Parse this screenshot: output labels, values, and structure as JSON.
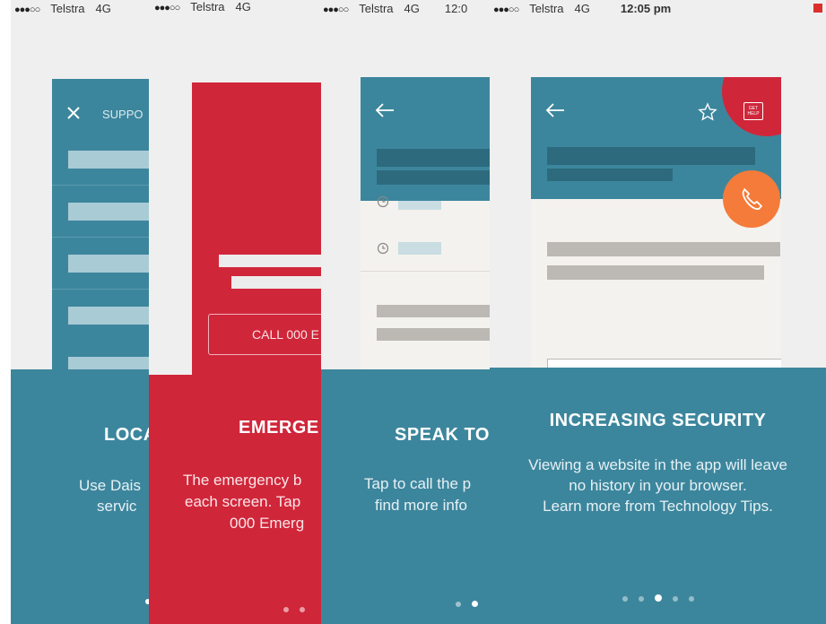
{
  "colors": {
    "teal": "#3c869d",
    "teal_dark": "#2e6f84",
    "red": "#d0263a",
    "orange": "#f47b3a",
    "grey_bar": "#b9b6b1"
  },
  "status_bar": {
    "dots": "●●●○○",
    "carrier": "Telstra",
    "network": "4G",
    "time": "12:05 pm",
    "time_short": "12:0"
  },
  "panel1": {
    "header_label": "SUPPO",
    "title": "LOCA",
    "body": [
      "Use Dais",
      "servic"
    ]
  },
  "panel2": {
    "button_label": "CALL 000 E",
    "title": "EMERGE",
    "body": [
      "The emergency b",
      "each screen. Tap",
      "000 Emerg"
    ]
  },
  "panel3": {
    "title": "SPEAK TO",
    "body": [
      "Tap to call the p",
      "find more info"
    ]
  },
  "panel4": {
    "badge_label": [
      "GET",
      "HELP"
    ],
    "title": "INCREASING SECURITY",
    "body": [
      "Viewing a website in the app will leave",
      "no history in your browser.",
      "Learn more from Technology Tips."
    ]
  }
}
